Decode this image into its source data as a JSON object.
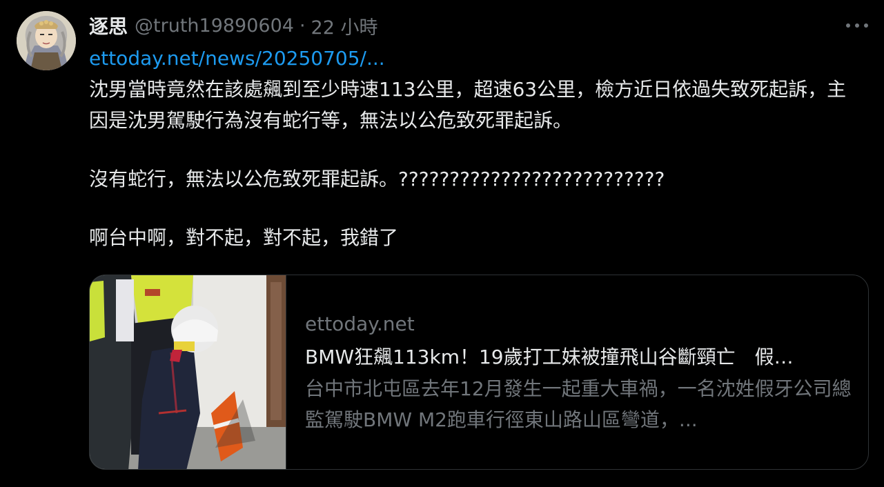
{
  "author": {
    "display_name": "逐思",
    "handle": "@truth19890604",
    "separator": "·",
    "time": "22 小時"
  },
  "icons": {
    "more": "more-horizontal-icon",
    "avatar": "avatar-image"
  },
  "tweet": {
    "link_text": "ettoday.net/news/20250705/...",
    "paragraph_1": "沈男當時竟然在該處飆到至少時速113公里，超速63公里，檢方近日依過失致死起訴，主因是沈男駕駛行為沒有蛇行等，無法以公危致死罪起訴。",
    "paragraph_2": "沒有蛇行，無法以公危致死罪起訴。??????????????????????????",
    "paragraph_3": "啊台中啊，對不起，對不起，我錯了"
  },
  "card": {
    "domain": "ettoday.net",
    "title": "BMW狂飆113km！19歲打工妹被撞飛山谷斷頸亡　假…",
    "description": "台中市北屯區去年12月發生一起重大車禍，一名沈姓假牙公司總監駕駛BMW M2跑車行徑東山路山區彎道，..."
  },
  "colors": {
    "background": "#000000",
    "text_primary": "#e7e9ea",
    "text_secondary": "#71767b",
    "link": "#1d9bf0",
    "border": "#2f3336"
  }
}
